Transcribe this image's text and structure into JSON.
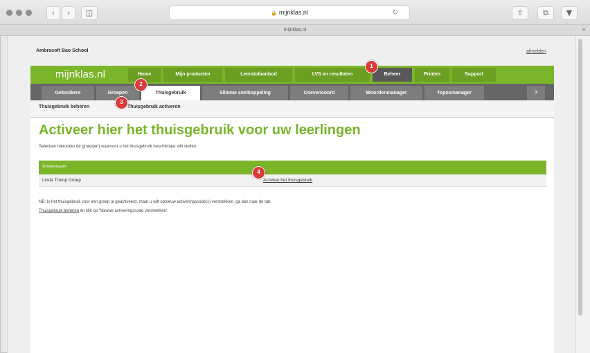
{
  "browser": {
    "address": "mijnklas.nl",
    "tab_title": "mijnklas.nl"
  },
  "header": {
    "school_name": "Ambrasoft Bao School",
    "logout": "afmelden",
    "logo": "mijnklas.nl"
  },
  "main_nav": [
    "Home",
    "Mijn producten",
    "Leerstofaanbod",
    "LVS en resultaten",
    "Beheer",
    "Printen",
    "Support"
  ],
  "main_nav_active": "Beheer",
  "sub_nav": [
    "Gebruikers",
    "Groepen",
    "Thuisgebruik",
    "Slimme snelkoppeling",
    "Coevencoord",
    "Woordenmanager",
    "Toposmanager",
    "?"
  ],
  "sub_nav_active": "Thuisgebruik",
  "third_nav": [
    "Thuisgebruik beheren",
    "Thuisgebruik activeren"
  ],
  "content": {
    "title": "Activeer hier het thuisgebruik voor uw leerlingen",
    "intro": "Selecteer hieronder de groep(en) waarvoor u het thuisgebruik beschikbaar wilt stellen.",
    "table_header": "Groepsnaam",
    "row_group": "Linda Tromp Groep",
    "row_action": "Activeer het thuisgebruik",
    "note_line1": "NB: Is het thuisgebruik voor een groep al geactiveerd, maar u wilt opnieuw activeringscode(s) verstrekken, ga dan naar de tab",
    "note_link": "Thuisgebruik beheren",
    "note_line2_rest": " en klik op 'Nieuwe activeringscode verstrekken'."
  },
  "callouts": [
    "1",
    "2",
    "3",
    "4"
  ],
  "colors": {
    "brand_green": "#7ab52a",
    "subnav_grey": "#666666",
    "callout_red": "#d93a3a"
  }
}
